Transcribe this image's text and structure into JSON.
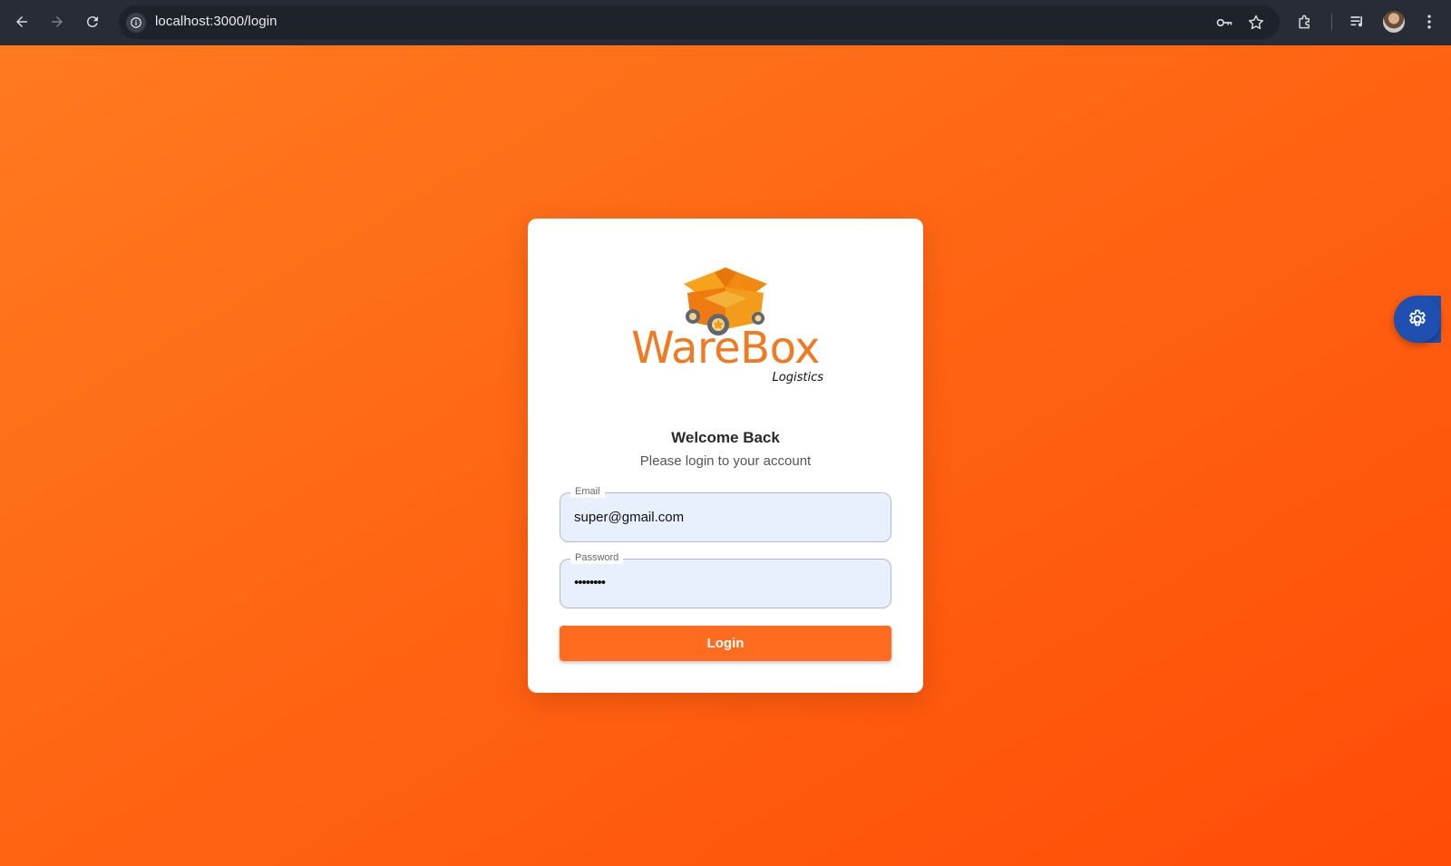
{
  "browser": {
    "url": "localhost:3000/login"
  },
  "brand": {
    "name": "WareBox",
    "tagline": "Logistics",
    "accent_color": "#f07a22"
  },
  "login": {
    "title": "Welcome Back",
    "subtitle": "Please login to your account",
    "email_label": "Email",
    "email_value": "super@gmail.com",
    "password_label": "Password",
    "password_masked": "••••••••",
    "submit_label": "Login",
    "button_color": "#ff6b1f"
  },
  "colors": {
    "background": "#ff6614",
    "fab": "#1f4fb0"
  },
  "icons": {
    "back": "arrow-left-icon",
    "forward": "arrow-right-icon",
    "reload": "reload-icon",
    "site_info": "info-icon",
    "passwords": "key-icon",
    "bookmark": "star-icon",
    "extensions": "puzzle-icon",
    "media": "media-control-icon",
    "menu": "kebab-menu-icon",
    "settings": "gear-icon"
  }
}
